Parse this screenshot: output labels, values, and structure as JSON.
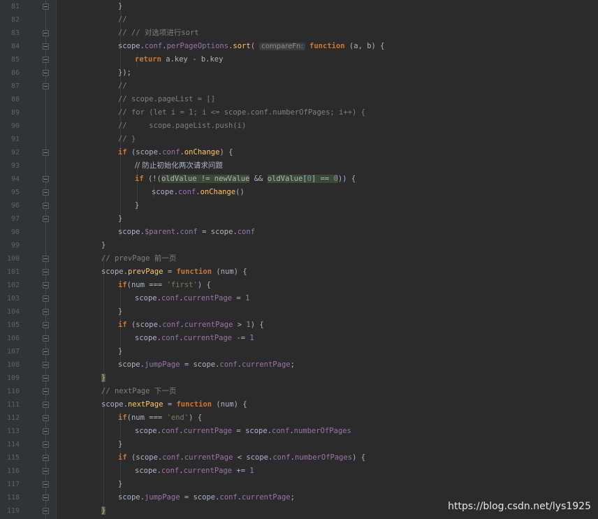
{
  "line_numbers": [
    "81",
    "82",
    "83",
    "84",
    "85",
    "86",
    "87",
    "88",
    "89",
    "90",
    "91",
    "92",
    "93",
    "94",
    "95",
    "96",
    "97",
    "98",
    "99",
    "100",
    "101",
    "102",
    "103",
    "104",
    "105",
    "106",
    "107",
    "108",
    "109",
    "110",
    "111",
    "112",
    "113",
    "114",
    "115",
    "116",
    "117",
    "118",
    "119"
  ],
  "code": {
    "l81": "}",
    "l82": "//",
    "l83": "// // 对选项进行sort",
    "l84_a": "scope.",
    "l84_b": "conf",
    "l84_c": ".",
    "l84_d": "perPageOptions",
    "l84_e": ".",
    "l84_f": "sort",
    "l84_g": "( ",
    "l84_hint": "compareFn:",
    "l84_h": " ",
    "l84_i": "function",
    "l84_j": " (a, b) {",
    "l85_a": "return",
    "l85_b": " a.key - b.key",
    "l86": "});",
    "l87": "//",
    "l88": "// scope.pageList = []",
    "l89": "// for (let i = 1; i <= scope.conf.numberOfPages; i++) {",
    "l90": "//     scope.pageList.push(i)",
    "l91": "// }",
    "l92_a": "if",
    "l92_b": " (scope.",
    "l92_c": "conf",
    "l92_d": ".",
    "l92_e": "onChange",
    "l92_f": ") {",
    "l93": "// 防止初始化两次请求问题",
    "l94_a": "if",
    "l94_b": " (!(",
    "l94_c": "oldValue != newValue",
    "l94_d": " && ",
    "l94_e": "oldValue[",
    "l94_f": "0",
    "l94_g": "] == ",
    "l94_h": "0",
    "l94_i": ")) {",
    "l95_a": "scope.",
    "l95_b": "conf",
    "l95_c": ".",
    "l95_d": "onChange",
    "l95_e": "()",
    "l96": "}",
    "l97": "}",
    "l98_a": "scope.",
    "l98_b": "$parent",
    "l98_c": ".",
    "l98_d": "conf",
    "l98_e": " = scope.",
    "l98_f": "conf",
    "l99": "}",
    "l100": "// prevPage 前一页",
    "l101_a": "scope.",
    "l101_b": "prevPage",
    "l101_c": " = ",
    "l101_d": "function",
    "l101_e": " (num) {",
    "l102_a": "if",
    "l102_b": "(num === ",
    "l102_c": "'first'",
    "l102_d": ") {",
    "l103_a": "scope.",
    "l103_b": "conf",
    "l103_c": ".",
    "l103_d": "currentPage",
    "l103_e": " = ",
    "l103_f": "1",
    "l104": "}",
    "l105_a": "if",
    "l105_b": " (scope.",
    "l105_c": "conf",
    "l105_d": ".",
    "l105_e": "currentPage",
    "l105_f": " > ",
    "l105_g": "1",
    "l105_h": ") {",
    "l106_a": "scope.",
    "l106_b": "conf",
    "l106_c": ".",
    "l106_d": "currentPage",
    "l106_e": " -= ",
    "l106_f": "1",
    "l107": "}",
    "l108_a": "scope.",
    "l108_b": "jumpPage",
    "l108_c": " = scope.",
    "l108_d": "conf",
    "l108_e": ".",
    "l108_f": "currentPage",
    "l108_g": ";",
    "l109": "}",
    "l110": "// nextPage 下一页",
    "l111_a": "scope.",
    "l111_b": "nextPage",
    "l111_c": " = ",
    "l111_d": "function",
    "l111_e": " (num) {",
    "l112_a": "if",
    "l112_b": "(num === ",
    "l112_c": "'end'",
    "l112_d": ") {",
    "l113_a": "scope.",
    "l113_b": "conf",
    "l113_c": ".",
    "l113_d": "currentPage",
    "l113_e": " = scope.",
    "l113_f": "conf",
    "l113_g": ".",
    "l113_h": "numberOfPages",
    "l114": "}",
    "l115_a": "if",
    "l115_b": " (scope.",
    "l115_c": "conf",
    "l115_d": ".",
    "l115_e": "currentPage",
    "l115_f": " < scope.",
    "l115_g": "conf",
    "l115_h": ".",
    "l115_i": "numberOfPages",
    "l115_j": ") {",
    "l116_a": "scope.",
    "l116_b": "conf",
    "l116_c": ".",
    "l116_d": "currentPage",
    "l116_e": " += ",
    "l116_f": "1",
    "l117": "}",
    "l118_a": "scope.",
    "l118_b": "jumpPage",
    "l118_c": " = scope.",
    "l118_d": "conf",
    "l118_e": ".",
    "l118_f": "currentPage",
    "l118_g": ";",
    "l119": "}"
  },
  "watermark": "https://blog.csdn.net/lys1925",
  "colors": {
    "background": "#2b2b2b",
    "gutter": "#313335",
    "keyword": "#cc7832",
    "function_name": "#ffc66d",
    "property": "#9876aa",
    "number": "#6897bb",
    "string": "#6a8759",
    "comment": "#808080",
    "text": "#a9b7c6"
  }
}
